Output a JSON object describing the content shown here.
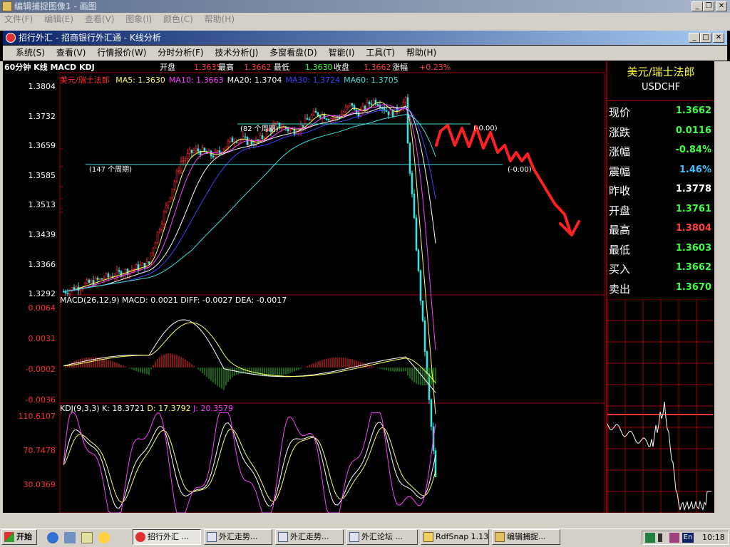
{
  "outer_window": {
    "title": "编辑捕捉图像1 - 画图",
    "menu": [
      "文件(F)",
      "编辑(E)",
      "查看(V)",
      "图象(I)",
      "颜色(C)",
      "帮助(H)"
    ]
  },
  "inner_window": {
    "title": "招行外汇 - 招商银行外汇通 - K线分析",
    "menu": [
      "系统(S)",
      "查看(V)",
      "行情报价(W)",
      "分时分析(F)",
      "技术分析(J)",
      "多窗看盘(D)",
      "智能(I)",
      "工具(T)",
      "帮助(H)"
    ]
  },
  "info_bar": {
    "chart_title": "60分钟 K线 MACD KDJ",
    "open_label": "开盘",
    "open_value": "1.3635",
    "high_label": "最高",
    "high_value": "1.3662",
    "low_label": "最低",
    "low_value": "1.3630",
    "close_label": "收盘",
    "close_value": "1.3662",
    "change_label": "涨幅",
    "change_value": "+0.23%"
  },
  "price_panel": {
    "symbol_name": "美元/瑞士法郎",
    "ma_legend": [
      {
        "text": "MA5: 1.3630",
        "color": "#ffff60"
      },
      {
        "text": "MA10: 1.3663",
        "color": "#ff40ff"
      },
      {
        "text": "MA20: 1.3704",
        "color": "#ffffff"
      },
      {
        "text": "MA30: 1.3724",
        "color": "#4040ff"
      },
      {
        "text": "MA60: 1.3705",
        "color": "#40e0e0"
      }
    ],
    "y_ticks": [
      "1.3804",
      "1.3732",
      "1.3659",
      "1.3585",
      "1.3513",
      "1.3439",
      "1.3366",
      "1.3292"
    ],
    "annotations": [
      "(147 个周期)",
      "(82 个周期)",
      "(-0.00)",
      "(-0.00)"
    ]
  },
  "macd_panel": {
    "legend": "MACD(26,12,9) MACD: 0.0021  DIFF: -0.0027  DEA: -0.0017",
    "y_ticks": [
      "0.0064",
      "0.0031",
      "-0.0002",
      "-0.0036"
    ]
  },
  "kdj_panel": {
    "legend_name": "KDJ(9,3,3)",
    "k": "K: 18.3721",
    "d": "D: 17.3792",
    "j": "J: 20.3579",
    "y_ticks": [
      "110.6107",
      "70.7478",
      "30.0369"
    ]
  },
  "quote_panel": {
    "name": "美元/瑞士法郎",
    "code": "USDCHF",
    "rows": [
      {
        "label": "现价",
        "value": "1.3662",
        "color": "#40ff40"
      },
      {
        "label": "涨跌",
        "value": "0.0116",
        "color": "#40ff40"
      },
      {
        "label": "涨幅",
        "value": "-0.84%",
        "color": "#40ff40"
      },
      {
        "label": "震幅",
        "value": "1.46%",
        "color": "#40c0ff"
      },
      {
        "label": "昨收",
        "value": "1.3778",
        "color": "#ffffff"
      },
      {
        "label": "开盘",
        "value": "1.3761",
        "color": "#40ff40"
      },
      {
        "label": "最高",
        "value": "1.3804",
        "color": "#ff4040"
      },
      {
        "label": "最低",
        "value": "1.3603",
        "color": "#40ff40"
      },
      {
        "label": "买入",
        "value": "1.3662",
        "color": "#40ff40"
      },
      {
        "label": "卖出",
        "value": "1.3670",
        "color": "#40ff40"
      }
    ]
  },
  "taskbar": {
    "start": "开始",
    "tasks": [
      "招行外汇 ...",
      "外汇走势...",
      "外汇走势...",
      "外汇论坛 ...",
      "RdfSnap 1.13",
      "编辑捕捉..."
    ],
    "tray_lang": "En",
    "clock": "10:18"
  }
}
